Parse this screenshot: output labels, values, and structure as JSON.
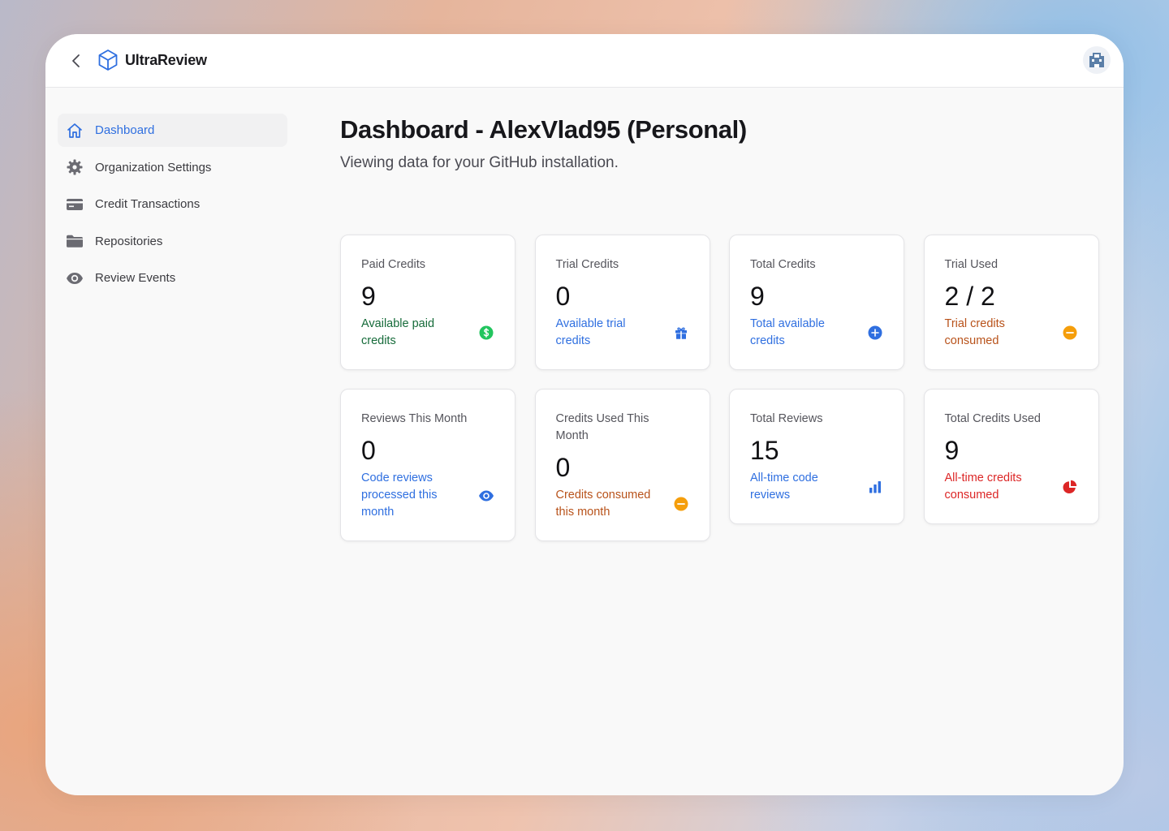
{
  "app": {
    "name": "UltraReview"
  },
  "sidebar": {
    "items": [
      {
        "label": "Dashboard",
        "icon": "home-icon",
        "active": true
      },
      {
        "label": "Organization Settings",
        "icon": "gear-icon",
        "active": false
      },
      {
        "label": "Credit Transactions",
        "icon": "credit-card-icon",
        "active": false
      },
      {
        "label": "Repositories",
        "icon": "folder-icon",
        "active": false
      },
      {
        "label": "Review Events",
        "icon": "eye-icon",
        "active": false
      }
    ]
  },
  "main": {
    "title": "Dashboard - AlexVlad95 (Personal)",
    "subtitle": "Viewing data for your GitHub installation.",
    "cards": [
      {
        "label": "Paid Credits",
        "value": "9",
        "desc": "Available paid credits",
        "icon": "dollar-icon",
        "tone": "green"
      },
      {
        "label": "Trial Credits",
        "value": "0",
        "desc": "Available trial credits",
        "icon": "gift-icon",
        "tone": "blue"
      },
      {
        "label": "Total Credits",
        "value": "9",
        "desc": "Total available credits",
        "icon": "plus-circle-icon",
        "tone": "blue"
      },
      {
        "label": "Trial Used",
        "value": "2 / 2",
        "desc": "Trial credits consumed",
        "icon": "minus-circle-icon",
        "tone": "orange"
      },
      {
        "label": "Reviews This Month",
        "value": "0",
        "desc": "Code reviews processed this month",
        "icon": "eye-icon",
        "tone": "blue"
      },
      {
        "label": "Credits Used This Month",
        "value": "0",
        "desc": "Credits consumed this month",
        "icon": "minus-circle-icon",
        "tone": "orange"
      },
      {
        "label": "Total Reviews",
        "value": "15",
        "desc": "All-time code reviews",
        "icon": "bar-chart-icon",
        "tone": "blue"
      },
      {
        "label": "Total Credits Used",
        "value": "9",
        "desc": "All-time credits consumed",
        "icon": "pie-chart-icon",
        "tone": "red"
      }
    ]
  },
  "colors": {
    "accent": "#2f6fe0",
    "green": "#22c55e",
    "orange": "#f59e0b",
    "red": "#dc2626"
  }
}
